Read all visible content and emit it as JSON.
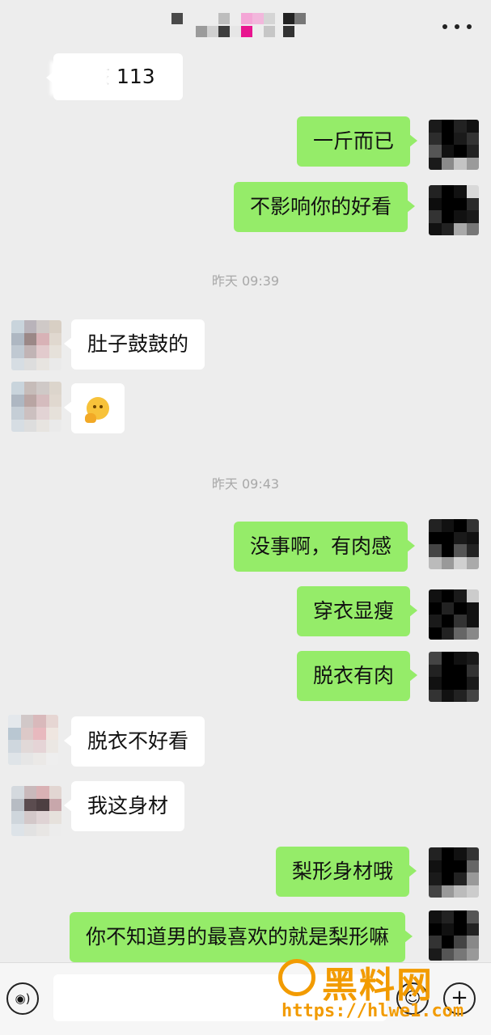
{
  "header": {
    "title_pixelated": true,
    "more_icon": "more-dots-icon"
  },
  "messages": [
    {
      "side": "other",
      "text": "亥该 113",
      "partially_obscured": true
    },
    {
      "side": "me",
      "text": "一斤而已"
    },
    {
      "side": "me",
      "text": "不影响你的好看"
    },
    {
      "type": "time",
      "text": "昨天 09:39"
    },
    {
      "side": "other",
      "text": "肚子鼓鼓的"
    },
    {
      "side": "other",
      "text": "",
      "emoji": "thinking-face-emoji"
    },
    {
      "type": "time",
      "text": "昨天 09:43"
    },
    {
      "side": "me",
      "text": "没事啊，有肉感"
    },
    {
      "side": "me",
      "text": "穿衣显瘦"
    },
    {
      "side": "me",
      "text": "脱衣有肉"
    },
    {
      "side": "other",
      "text": "脱衣不好看"
    },
    {
      "side": "other",
      "text": "我这身材"
    },
    {
      "side": "me",
      "text": "梨形身材哦"
    },
    {
      "side": "me",
      "text": "你不知道男的最喜欢的就是梨形嘛"
    }
  ],
  "bottom_bar": {
    "voice_icon": "voice-icon",
    "emoji_icon": "emoji-icon",
    "plus_icon": "plus-icon",
    "input_value": ""
  },
  "watermark": {
    "title": "黑料网",
    "url": "https://hlwe1.com"
  },
  "colors": {
    "background": "#ededed",
    "my_bubble": "#95ec69",
    "other_bubble": "#ffffff",
    "timestamp": "#a8a8a8",
    "watermark": "#f29b00"
  }
}
